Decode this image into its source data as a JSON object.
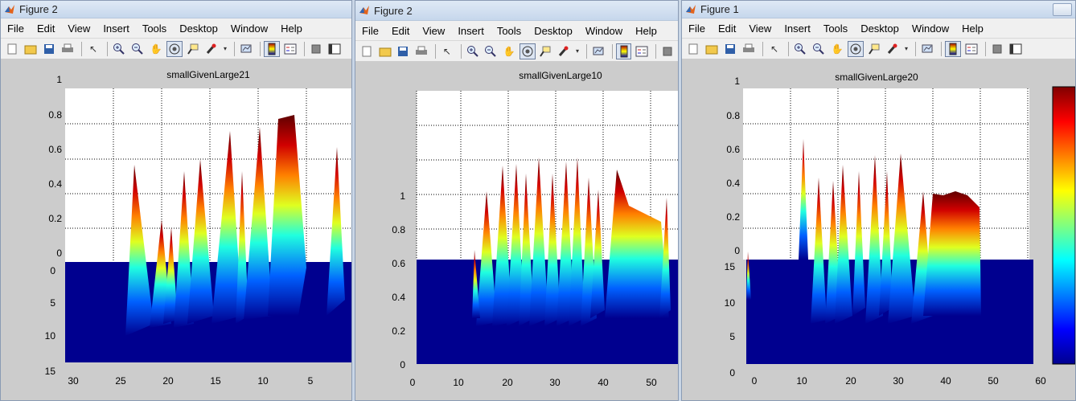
{
  "windows": [
    {
      "title": "Figure 2",
      "menus": [
        "File",
        "Edit",
        "View",
        "Insert",
        "Tools",
        "Desktop",
        "Window",
        "Help"
      ],
      "plot_title": "smallGivenLarge21",
      "z_ticks": [
        "1",
        "0.8",
        "0.6",
        "0.4",
        "0.2",
        "0"
      ],
      "y_ticks": [
        "0",
        "5",
        "10",
        "15"
      ],
      "x_ticks": [
        "30",
        "25",
        "20",
        "15",
        "10",
        "5"
      ]
    },
    {
      "title": "Figure 2",
      "menus": [
        "File",
        "Edit",
        "View",
        "Insert",
        "Tools",
        "Desktop",
        "Window",
        "Help"
      ],
      "plot_title": "smallGivenLarge10",
      "z_ticks": [
        "1",
        "0.8",
        "0.6",
        "0.4",
        "0.2",
        "0"
      ],
      "x_ticks": [
        "0",
        "10",
        "20",
        "30",
        "40",
        "50"
      ]
    },
    {
      "title": "Figure 1",
      "menus": [
        "File",
        "Edit",
        "View",
        "Insert",
        "Tools",
        "Desktop",
        "Window",
        "Help"
      ],
      "plot_title": "smallGivenLarge20",
      "z_ticks": [
        "1",
        "0.8",
        "0.6",
        "0.4",
        "0.2",
        "0"
      ],
      "y_ticks": [
        "15",
        "10",
        "5",
        "0"
      ],
      "x_ticks": [
        "0",
        "10",
        "20",
        "30",
        "40",
        "50",
        "60"
      ]
    }
  ],
  "toolbar_icons": [
    "new-file",
    "open-folder",
    "save",
    "print",
    "pointer",
    "zoom-in",
    "zoom-out",
    "pan-hand",
    "rotate-3d",
    "data-cursor",
    "brush",
    "link-plot",
    "colorbar",
    "legend",
    "hide-plot-tools",
    "show-plot-tools"
  ],
  "colors": {
    "colormap": "jet",
    "surface_base": "#00008f",
    "figure_bg": "#cccccc"
  }
}
